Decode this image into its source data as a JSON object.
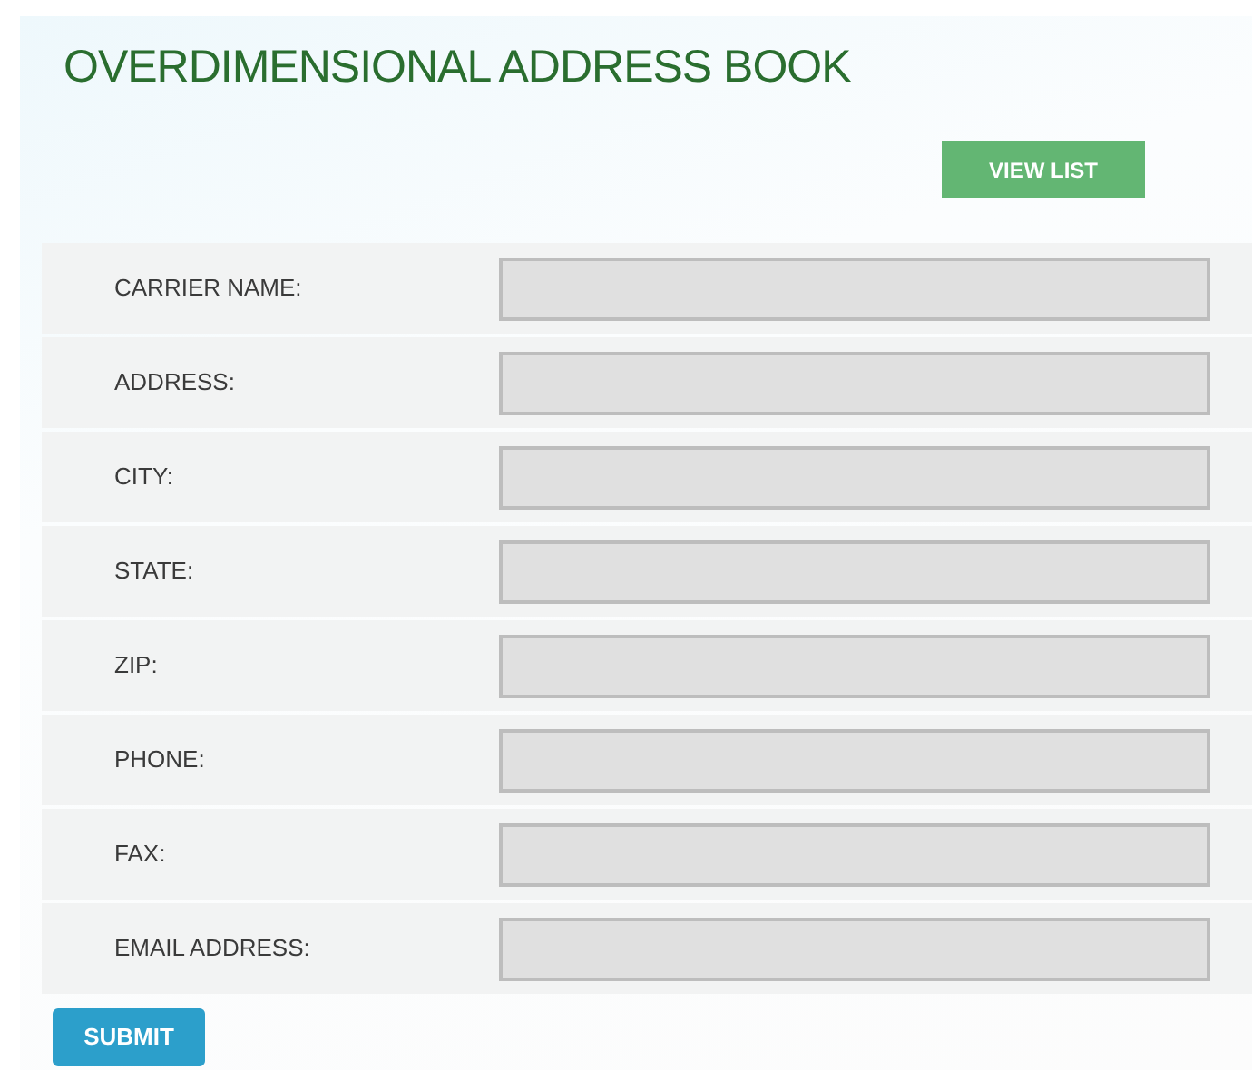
{
  "title": "OVERDIMENSIONAL ADDRESS BOOK",
  "view_button": "VIEW LIST",
  "fields": [
    {
      "label": "CARRIER NAME:"
    },
    {
      "label": "ADDRESS:"
    },
    {
      "label": "CITY:"
    },
    {
      "label": "STATE:"
    },
    {
      "label": "ZIP:"
    },
    {
      "label": "PHONE:"
    },
    {
      "label": "FAX:"
    },
    {
      "label": "EMAIL ADDRESS:"
    }
  ],
  "submit_button": "SUBMIT"
}
